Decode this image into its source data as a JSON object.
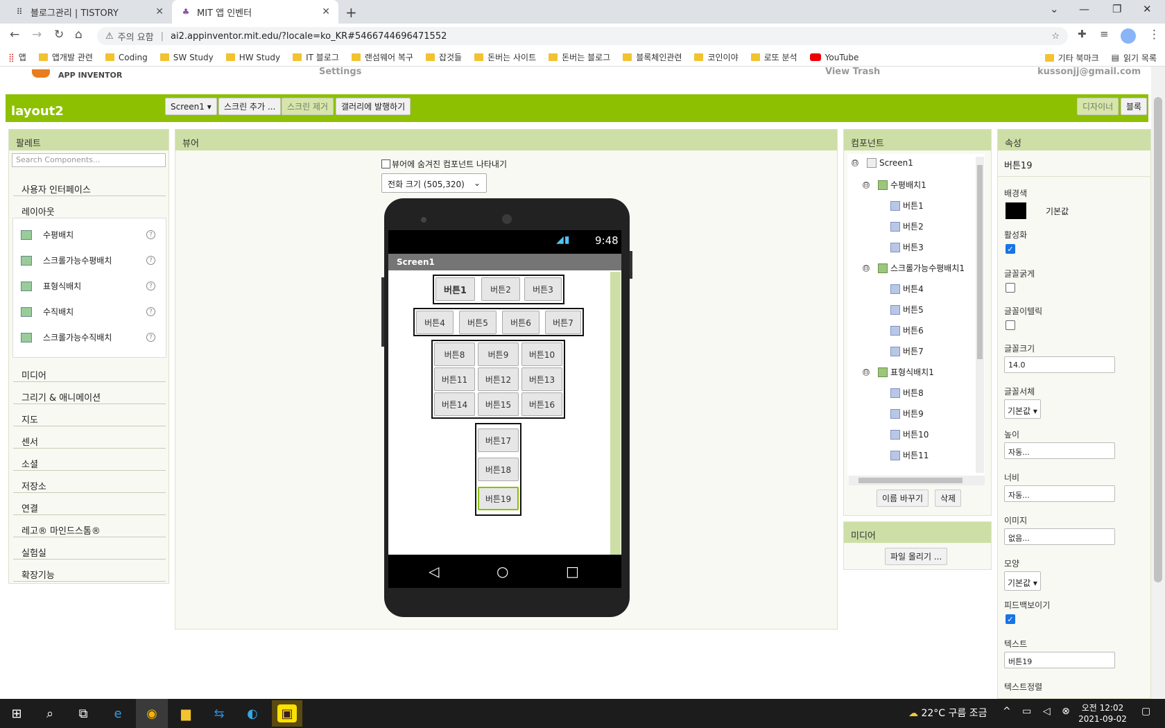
{
  "browser": {
    "tabs": [
      {
        "title": "블로그관리 | TISTORY",
        "active": false
      },
      {
        "title": "MIT 앱 인벤터",
        "active": true
      }
    ],
    "security_label": "주의 요함",
    "url": "ai2.appinventor.mit.edu/?locale=ko_KR#5466744696471552",
    "bookmarks": [
      "앱",
      "앱개발 관련",
      "Coding",
      "SW Study",
      "HW Study",
      "IT 블로그",
      "랜섬웨어 복구",
      "잡것들",
      "돈버는 사이트",
      "돈버는 블로그",
      "블록체인관련",
      "코인이야",
      "로또 분석",
      "YouTube"
    ],
    "bookmarks_right": [
      "기타 북마크",
      "읽기 목록"
    ]
  },
  "appinventor": {
    "logo_text": "APP INVENTOR",
    "header_faded": "Settings",
    "header_user": "kussonjj@gmail.com",
    "header_trash": "View Trash",
    "project_name": "layout2",
    "toolbar": {
      "screen_select": "Screen1 ▾",
      "add_screen": "스크린 추가 ...",
      "remove_screen": "스크린 제거",
      "publish_gallery": "갤러리에 발행하기",
      "designer": "디자이너",
      "blocks": "블록"
    },
    "palette": {
      "title": "팔레트",
      "search_placeholder": "Search Components...",
      "categories": [
        "사용자 인터페이스",
        "레이아웃",
        "미디어",
        "그리기 & 애니메이션",
        "지도",
        "센서",
        "소셜",
        "저장소",
        "연결",
        "레고® 마인드스톰®",
        "실험실",
        "확장기능"
      ],
      "layout_items": [
        "수평배치",
        "스크롤가능수평배치",
        "표형식배치",
        "수직배치",
        "스크롤가능수직배치"
      ],
      "help": "?"
    },
    "viewer": {
      "title": "뷰어",
      "hidden_checkbox_label": "뷰어에 숨겨진 컴포넌트 나타내기",
      "size_select": "전화 크기 (505,320)",
      "status_time": "9:48",
      "screen_title": "Screen1",
      "row1": [
        "버튼1",
        "버튼2",
        "버튼3"
      ],
      "row2": [
        "버튼4",
        "버튼5",
        "버튼6",
        "버튼7"
      ],
      "table": [
        "버튼8",
        "버튼9",
        "버튼10",
        "버튼11",
        "버튼12",
        "버튼13",
        "버튼14",
        "버튼15",
        "버튼16"
      ],
      "column": [
        "버튼17",
        "버튼18",
        "버튼19"
      ]
    },
    "components": {
      "title": "컴포넌트",
      "tree": [
        {
          "label": "Screen1",
          "level": 0,
          "type": "screen",
          "toggle": "⊟"
        },
        {
          "label": "수평배치1",
          "level": 1,
          "type": "layout",
          "toggle": "⊟"
        },
        {
          "label": "버튼1",
          "level": 2,
          "type": "button"
        },
        {
          "label": "버튼2",
          "level": 2,
          "type": "button"
        },
        {
          "label": "버튼3",
          "level": 2,
          "type": "button"
        },
        {
          "label": "스크롤가능수평배치1",
          "level": 1,
          "type": "layout",
          "toggle": "⊟"
        },
        {
          "label": "버튼4",
          "level": 2,
          "type": "button"
        },
        {
          "label": "버튼5",
          "level": 2,
          "type": "button"
        },
        {
          "label": "버튼6",
          "level": 2,
          "type": "button"
        },
        {
          "label": "버튼7",
          "level": 2,
          "type": "button"
        },
        {
          "label": "표형식배치1",
          "level": 1,
          "type": "layout",
          "toggle": "⊟"
        },
        {
          "label": "버튼8",
          "level": 2,
          "type": "button"
        },
        {
          "label": "버튼9",
          "level": 2,
          "type": "button"
        },
        {
          "label": "버튼10",
          "level": 2,
          "type": "button"
        },
        {
          "label": "버튼11",
          "level": 2,
          "type": "button"
        }
      ],
      "rename": "이름 바꾸기",
      "delete": "삭제"
    },
    "media": {
      "title": "미디어",
      "upload": "파일 올리기 ..."
    },
    "properties": {
      "title": "속성",
      "selected": "버튼19",
      "bg_color_label": "배경색",
      "bg_color_value": "기본값",
      "bg_color": "#000000",
      "enabled_label": "활성화",
      "enabled": true,
      "bold_label": "글꼴굵게",
      "bold": false,
      "italic_label": "글꼴이텔릭",
      "italic": false,
      "fontsize_label": "글꼴크기",
      "fontsize": "14.0",
      "typeface_label": "글꼴서체",
      "typeface": "기본값 ▾",
      "height_label": "높이",
      "height": "자동...",
      "width_label": "너비",
      "width": "자동...",
      "image_label": "이미지",
      "image": "없음...",
      "shape_label": "모양",
      "shape": "기본값 ▾",
      "feedback_label": "피드백보이기",
      "feedback": true,
      "text_label": "텍스트",
      "text": "버튼19",
      "align_label": "텍스트정렬"
    }
  },
  "taskbar": {
    "weather": "22°C 구름 조금",
    "time": "오전 12:02",
    "date": "2021-09-02"
  },
  "colors": {
    "accent_green": "#8dc001",
    "panel_header": "#cddfa6",
    "chrome_tab_bar": "#dee1e6"
  }
}
